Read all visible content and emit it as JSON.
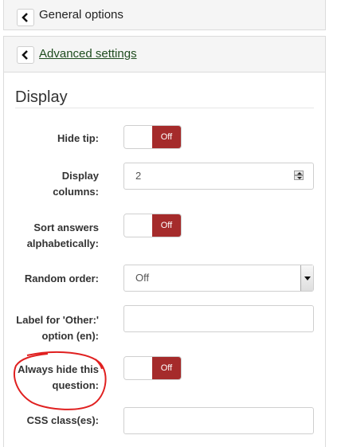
{
  "panels": {
    "general": {
      "title": "General options"
    },
    "advanced": {
      "title": "Advanced settings"
    }
  },
  "section": {
    "title": "Display"
  },
  "fields": {
    "hide_tip": {
      "label": "Hide tip:",
      "toggle": "Off"
    },
    "display_columns": {
      "label_line1": "Display",
      "label_line2": "columns:",
      "value": "2"
    },
    "sort_answers": {
      "label_line1": "Sort answers",
      "label_line2": "alphabetically:",
      "toggle": "Off"
    },
    "random_order": {
      "label": "Random order:",
      "selected": "Off"
    },
    "label_other": {
      "label_line1": "Label for 'Other:'",
      "label_line2": "option (en):",
      "value": ""
    },
    "always_hide": {
      "label_line1": "Always hide this",
      "label_line2": "question:",
      "toggle": "Off"
    },
    "css_class": {
      "label": "CSS class(es):",
      "value": ""
    }
  },
  "colors": {
    "toggle_off": "#a52b2b",
    "annotation": "#e02020"
  },
  "icons": {
    "panel_toggle": "chevron-left-icon",
    "spinner": "spinner-arrows-icon",
    "select": "chevron-down-icon"
  }
}
